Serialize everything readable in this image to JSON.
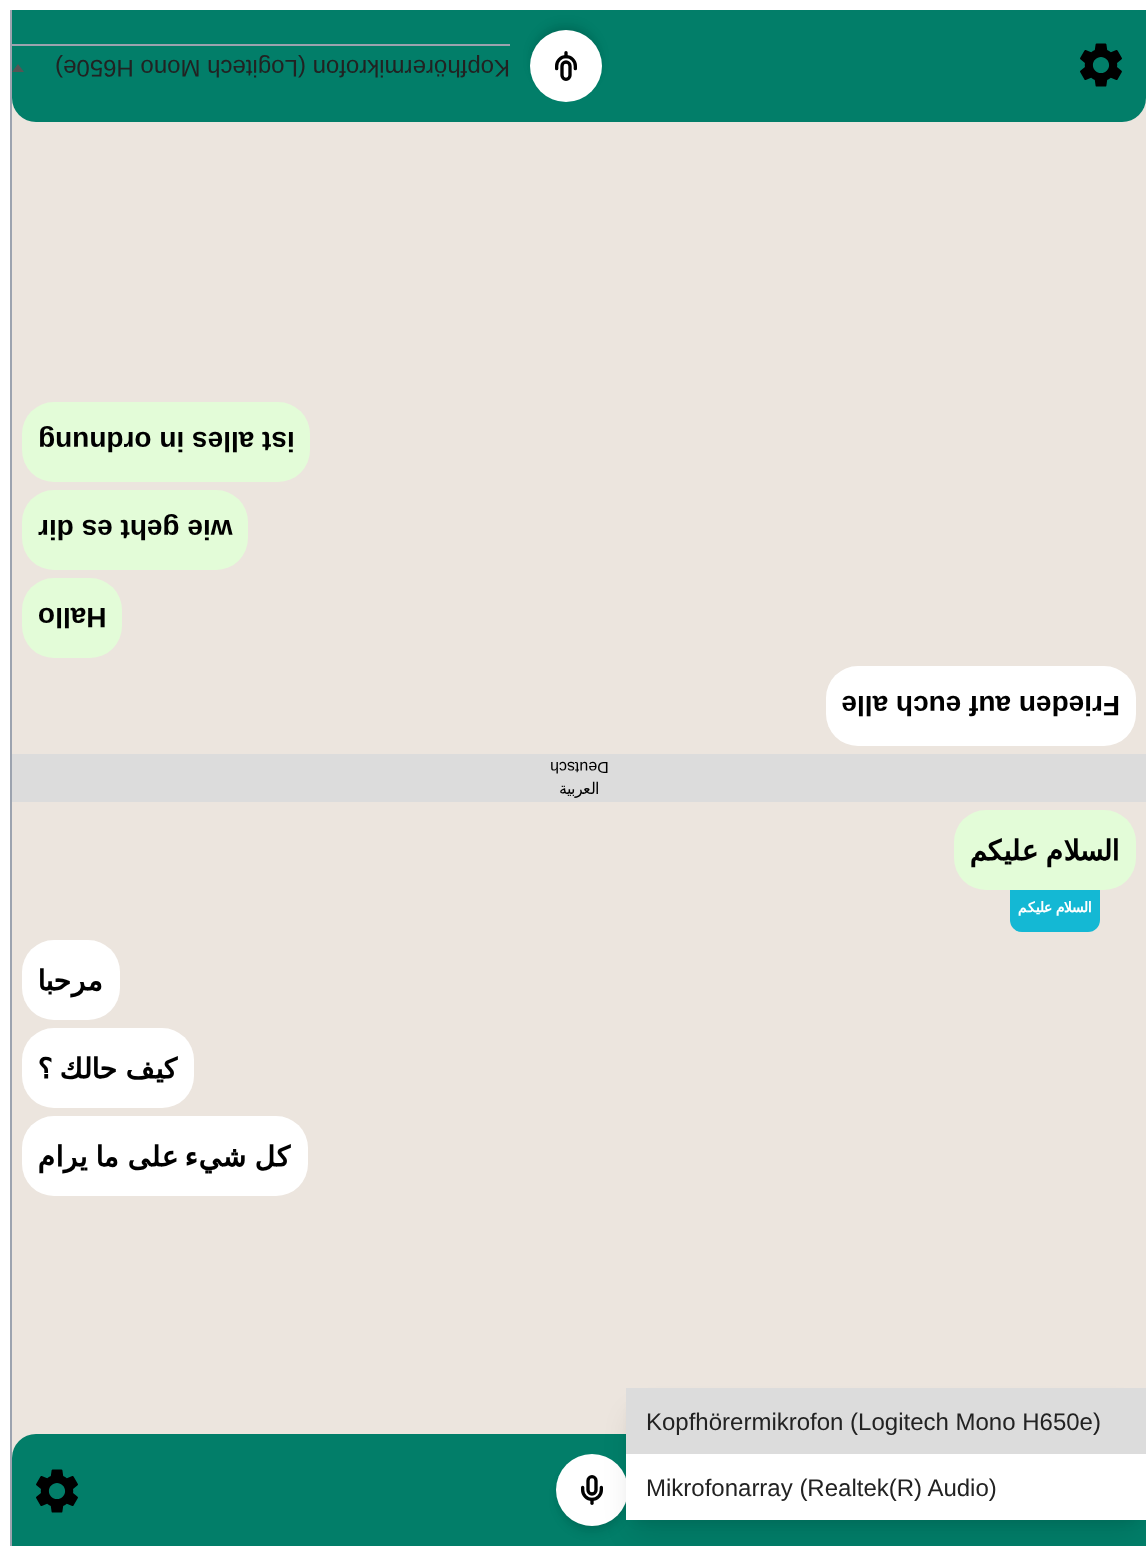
{
  "panels": [
    {
      "language": "Deutsch",
      "upside_down": true,
      "messages": [
        {
          "text": "Frieden auf euch alle",
          "kind": "incoming"
        },
        {
          "text": "Hallo",
          "kind": "outgoing"
        },
        {
          "text": "wie geht es dir",
          "kind": "outgoing"
        },
        {
          "text": "ist alles in ordnung",
          "kind": "outgoing"
        }
      ],
      "device_select": {
        "open": false,
        "value": "Kopfhörermikrofon (Logitech Mono H650e)"
      }
    },
    {
      "language": "العربية",
      "upside_down": false,
      "messages": [
        {
          "text": "السلام عليكم",
          "kind": "outgoing",
          "translation": "السلام عليكم"
        },
        {
          "text": "مرحبا",
          "kind": "incoming"
        },
        {
          "text": "كيف حالك ؟",
          "kind": "incoming"
        },
        {
          "text": "كل شيء على ما يرام",
          "kind": "incoming"
        }
      ],
      "device_select": {
        "open": true,
        "options": [
          {
            "label": "Kopfhörermikrofon (Logitech Mono H650e)",
            "selected": true
          },
          {
            "label": "Mikrofonarray (Realtek(R) Audio)",
            "selected": false
          }
        ]
      }
    }
  ]
}
